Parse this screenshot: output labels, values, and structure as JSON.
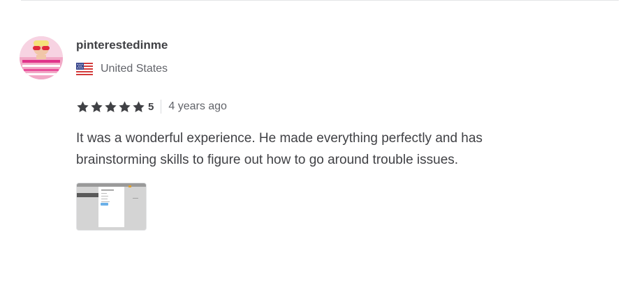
{
  "review": {
    "username": "pinterestedinme",
    "country": "United States",
    "country_flag_icon": "us-flag-icon",
    "rating": "5",
    "stars_filled": 5,
    "stars_total": 5,
    "star_color": "#404145",
    "time_ago": "4 years ago",
    "text": "It was a wonderful experience. He made everything perfectly and has brainstorming skills to figure out how to go around trouble issues.",
    "attachment_icon": "screenshot-thumbnail"
  }
}
